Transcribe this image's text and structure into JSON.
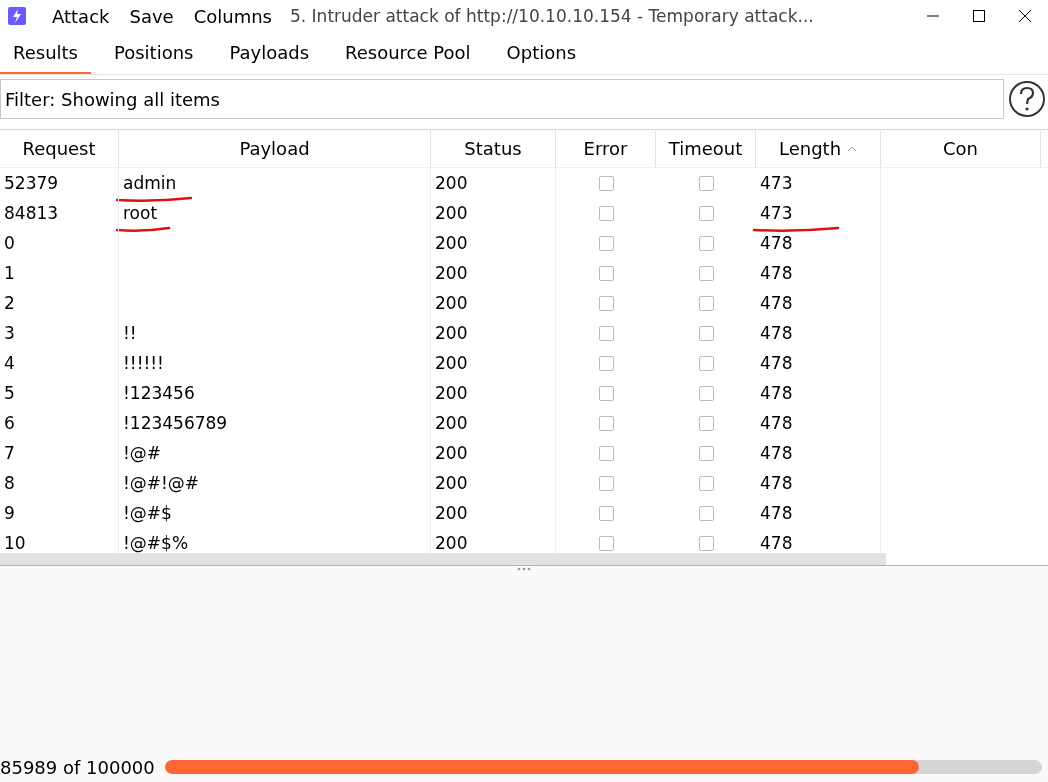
{
  "menu": [
    "Attack",
    "Save",
    "Columns"
  ],
  "window": {
    "title": "5. Intruder attack of http://10.10.10.154 - Temporary attack..."
  },
  "tabs": [
    {
      "label": "Results",
      "selected": true
    },
    {
      "label": "Positions",
      "selected": false
    },
    {
      "label": "Payloads",
      "selected": false
    },
    {
      "label": "Resource Pool",
      "selected": false
    },
    {
      "label": "Options",
      "selected": false
    }
  ],
  "filter": {
    "value": "Filter: Showing all items"
  },
  "table": {
    "columns": [
      {
        "label": "Request",
        "sorted": false
      },
      {
        "label": "Payload",
        "sorted": false
      },
      {
        "label": "Status",
        "sorted": false
      },
      {
        "label": "Error",
        "sorted": false
      },
      {
        "label": "Timeout",
        "sorted": false
      },
      {
        "label": "Length",
        "sorted": true
      },
      {
        "label": "Con",
        "sorted": false
      }
    ],
    "rows": [
      {
        "request": "52379",
        "payload": "admin",
        "payload_marked": true,
        "status": "200",
        "error": false,
        "timeout": false,
        "length": "473",
        "length_marked": false
      },
      {
        "request": "84813",
        "payload": "root",
        "payload_marked": true,
        "status": "200",
        "error": false,
        "timeout": false,
        "length": "473",
        "length_marked": true
      },
      {
        "request": "0",
        "payload_marked": false,
        "status": "200",
        "error": false,
        "timeout": false,
        "length": "478",
        "length_marked": false
      },
      {
        "request": "1",
        "payload_marked": false,
        "status": "200",
        "error": false,
        "timeout": false,
        "length": "478",
        "length_marked": false
      },
      {
        "request": "2",
        "payload_marked": false,
        "status": "200",
        "error": false,
        "timeout": false,
        "length": "478",
        "length_marked": false
      },
      {
        "request": "3",
        "payload": "!!",
        "payload_marked": false,
        "status": "200",
        "error": false,
        "timeout": false,
        "length": "478",
        "length_marked": false
      },
      {
        "request": "4",
        "payload": "!!!!!!",
        "payload_marked": false,
        "status": "200",
        "error": false,
        "timeout": false,
        "length": "478",
        "length_marked": false
      },
      {
        "request": "5",
        "payload": "!123456",
        "payload_marked": false,
        "status": "200",
        "error": false,
        "timeout": false,
        "length": "478",
        "length_marked": false
      },
      {
        "request": "6",
        "payload": "!123456789",
        "payload_marked": false,
        "status": "200",
        "error": false,
        "timeout": false,
        "length": "478",
        "length_marked": false
      },
      {
        "request": "7",
        "payload": "!@#",
        "payload_marked": false,
        "status": "200",
        "error": false,
        "timeout": false,
        "length": "478",
        "length_marked": false
      },
      {
        "request": "8",
        "payload": "!@#!@#",
        "payload_marked": false,
        "status": "200",
        "error": false,
        "timeout": false,
        "length": "478",
        "length_marked": false
      },
      {
        "request": "9",
        "payload": "!@#$",
        "payload_marked": false,
        "status": "200",
        "error": false,
        "timeout": false,
        "length": "478",
        "length_marked": false
      },
      {
        "request": "10",
        "payload": "!@#$%",
        "payload_marked": false,
        "status": "200",
        "error": false,
        "timeout": false,
        "length": "478",
        "length_marked": false
      }
    ]
  },
  "status_bar": {
    "progress_text": "85989 of 100000",
    "level": 0.86
  }
}
